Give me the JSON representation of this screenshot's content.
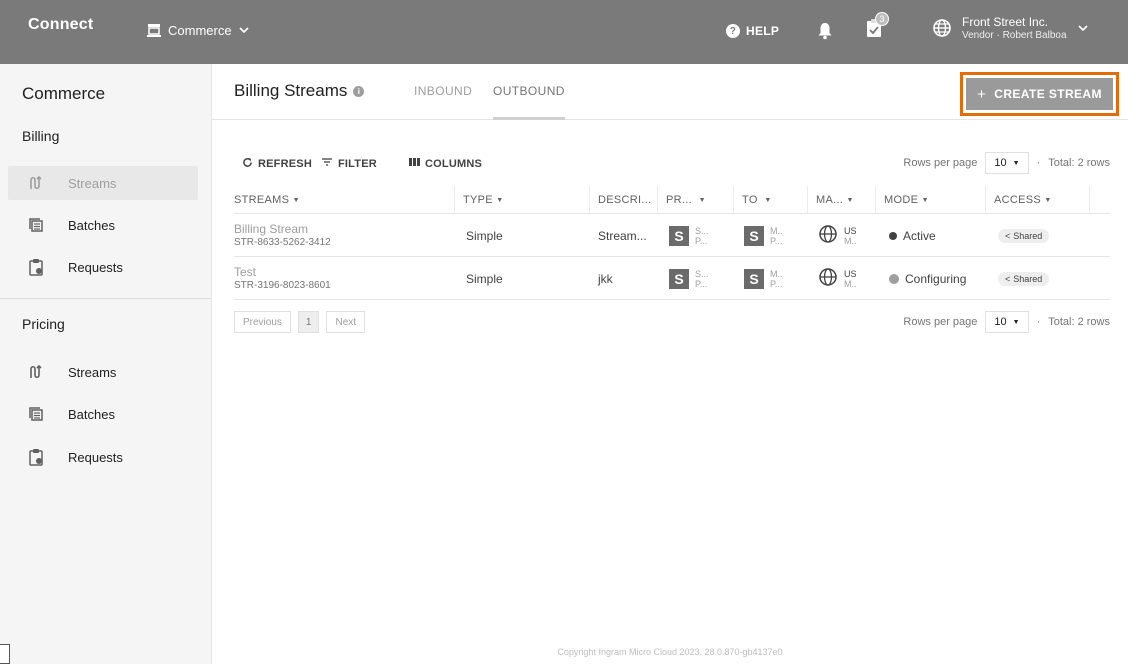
{
  "topbar": {
    "brand": "Connect",
    "module": "Commerce",
    "help": "HELP",
    "tasks_count": "3",
    "account_name": "Front Street Inc.",
    "account_sub": "Vendor · Robert Balboa"
  },
  "sidebar": {
    "title": "Commerce",
    "sections": [
      {
        "label": "Billing",
        "items": [
          {
            "label": "Streams",
            "icon": "streams-icon"
          },
          {
            "label": "Batches",
            "icon": "batches-icon"
          },
          {
            "label": "Requests",
            "icon": "requests-icon"
          }
        ]
      },
      {
        "label": "Pricing",
        "items": [
          {
            "label": "Streams",
            "icon": "streams-icon"
          },
          {
            "label": "Batches",
            "icon": "batches-icon"
          },
          {
            "label": "Requests",
            "icon": "requests-icon"
          }
        ]
      }
    ]
  },
  "header": {
    "title": "Billing Streams",
    "tabs": [
      "INBOUND",
      "OUTBOUND"
    ],
    "create_label": "CREATE STREAM"
  },
  "toolbar": {
    "refresh": "REFRESH",
    "filter": "FILTER",
    "columns": "COLUMNS",
    "rows_per_page_label": "Rows per page",
    "rows_per_page_value": "10",
    "total": "Total: 2 rows"
  },
  "table": {
    "columns": [
      "STREAMS",
      "TYPE",
      "DESCRI...",
      "PR...",
      "TO",
      "MA...",
      "MODE",
      "ACCESS"
    ],
    "rows": [
      {
        "name": "Billing Stream",
        "id": "STR-8633-5262-3412",
        "type": "Simple",
        "description": "Stream...",
        "pr_letter": "S",
        "pr_line1": "S...",
        "pr_line2": "P...",
        "to_letter": "S",
        "to_line1": "M..",
        "to_line2": "P...",
        "ma_line1": "US",
        "ma_line2": "M..",
        "mode": "Active",
        "access": "Shared"
      },
      {
        "name": "Test",
        "id": "STR-3196-8023-8601",
        "type": "Simple",
        "description": "jkk",
        "pr_letter": "S",
        "pr_line1": "S...",
        "pr_line2": "P...",
        "to_letter": "S",
        "to_line1": "M..",
        "to_line2": "P...",
        "ma_line1": "US",
        "ma_line2": "M..",
        "mode": "Configuring",
        "access": "Shared"
      }
    ]
  },
  "pagination": {
    "previous": "Previous",
    "page": "1",
    "next": "Next"
  },
  "footer": "Copyright Ingram Micro Cloud 2023. 28.0.870-gb4137e0",
  "colors": {
    "topbar": "#7a7a7a",
    "highlight": "#e36c0a",
    "button": "#9a9a9a"
  }
}
